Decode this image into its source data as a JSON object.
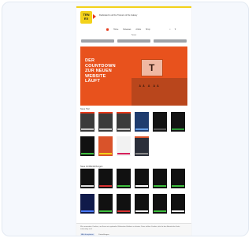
{
  "header": {
    "logo_top": "TEN",
    "logo_bottom": "EX",
    "tagline": "Dedicated to all the Trainers of the Galaxy",
    "nav_items": [
      "Home",
      "Releases",
      "Artists",
      "Shop"
    ],
    "sub_nav": "Tenex"
  },
  "tabs": [
    "",
    "",
    ""
  ],
  "hero": {
    "headline": "DER\nCOUNTDOWN\nZUR NEUEN\nWEBSITE\nLÄUFT",
    "sign_letter": "T"
  },
  "sections": [
    {
      "title": "Neue Titel"
    },
    {
      "title": "Neue Veröffentlichungen"
    }
  ],
  "thumbs_row1": [
    {
      "color": "#3b3b3b",
      "badge": "#e63a1c",
      "label": "#c7c7c7"
    },
    {
      "color": "#3b3b3b",
      "badge": "#e63a1c",
      "label": "#c7c7c7"
    },
    {
      "color": "#3b3b3b",
      "badge": "#e63a1c",
      "label": "#c7c7c7"
    },
    {
      "color": "#1f3c6e",
      "badge": "#1f3c6e",
      "label": "#6aa0e6"
    },
    {
      "color": "#141414",
      "badge": "#141414",
      "label": "#555555"
    },
    {
      "color": "#141414",
      "badge": "#141414",
      "label": "#2f9a3a"
    }
  ],
  "thumbs_row2": [
    {
      "color": "#111111",
      "badge": "#111111",
      "label": "#3fbf3f"
    },
    {
      "color": "#d9532a",
      "badge": "#d9532a",
      "label": "#f3d21a"
    },
    {
      "color": "#f2f2f2",
      "badge": "#f2f2f2",
      "label": "#d61f5b"
    },
    {
      "color": "#2b2f3a",
      "badge": "#d9532a",
      "label": "#888888"
    }
  ],
  "thumbs_row3": [
    {
      "color": "#111111",
      "badge": "#111111",
      "label": "#e0e0e0"
    },
    {
      "color": "#111111",
      "badge": "#111111",
      "label": "#d93333"
    },
    {
      "color": "#111111",
      "badge": "#111111",
      "label": "#3fbf3f"
    },
    {
      "color": "#111111",
      "badge": "#111111",
      "label": "#ffffff"
    },
    {
      "color": "#111111",
      "badge": "#111111",
      "label": "#3fbf3f"
    },
    {
      "color": "#111111",
      "badge": "#111111",
      "label": "#3fbf3f"
    }
  ],
  "thumbs_row4": [
    {
      "color": "#101a4a",
      "badge": "#101a4a",
      "label": "#4a7bff"
    },
    {
      "color": "#111111",
      "badge": "#111111",
      "label": "#3fbf3f"
    },
    {
      "color": "#111111",
      "badge": "#111111",
      "label": "#d93333"
    },
    {
      "color": "#111111",
      "badge": "#111111",
      "label": "#ffffff"
    },
    {
      "color": "#111111",
      "badge": "#111111",
      "label": "#3fbf3f"
    },
    {
      "color": "#111111",
      "badge": "#111111",
      "label": "#ffffff"
    }
  ],
  "consent": {
    "text": "Wir verwenden Cookies, um Ihnen ein optimales Webseiten-Erlebnis zu bieten. Dazu zählen Cookies, die für den Betrieb der Seite notwendig sind.",
    "accept_label": "Alle akzeptieren",
    "settings_label": "Einstellungen"
  },
  "colors": {
    "brand_yellow": "#f3d21a",
    "hero_orange": "#e8521d",
    "accent_red": "#e63a1c"
  }
}
